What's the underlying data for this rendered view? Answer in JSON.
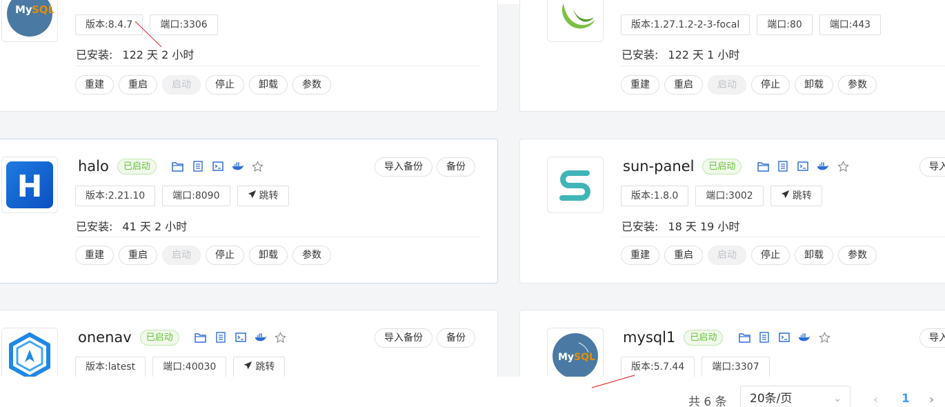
{
  "labels": {
    "installed": "已安装:",
    "status_running": "已启动",
    "import_backup": "导入备份",
    "backup": "备份",
    "jump": "跳转",
    "rebuild": "重建",
    "restart": "重启",
    "start": "启动",
    "stop": "停止",
    "uninstall": "卸载",
    "params": "参数",
    "import_partial": "导入"
  },
  "apps": [
    {
      "name": "",
      "version": "版本:8.4.7",
      "ports": [
        "端口:3306"
      ],
      "installed": "122 天 2 小时",
      "logo": "mysql"
    },
    {
      "name": "",
      "version": "版本:1.27.1.2-2-3-focal",
      "ports": [
        "端口:80",
        "端口:443"
      ],
      "installed": "122 天 1 小时",
      "logo": "openresty"
    },
    {
      "name": "halo",
      "version": "版本:2.21.10",
      "ports": [
        "端口:8090"
      ],
      "installed": "41 天 2 小时",
      "logo": "halo"
    },
    {
      "name": "sun-panel",
      "version": "版本:1.8.0",
      "ports": [
        "端口:3002"
      ],
      "installed": "18 天 19 小时",
      "logo": "sun-panel"
    },
    {
      "name": "onenav",
      "version": "版本:latest",
      "ports": [
        "端口:40030"
      ],
      "installed": "",
      "logo": "onenav"
    },
    {
      "name": "mysql1",
      "version": "版本:5.7.44",
      "ports": [
        "端口:3307"
      ],
      "installed": "",
      "logo": "mysql"
    }
  ],
  "pagination": {
    "total": "共 6 条",
    "page_size": "20条/页",
    "current_page": "1"
  },
  "colors": {
    "accent": "#409eff",
    "status_green": "#67c23a",
    "annotation_red": "#e53935"
  }
}
